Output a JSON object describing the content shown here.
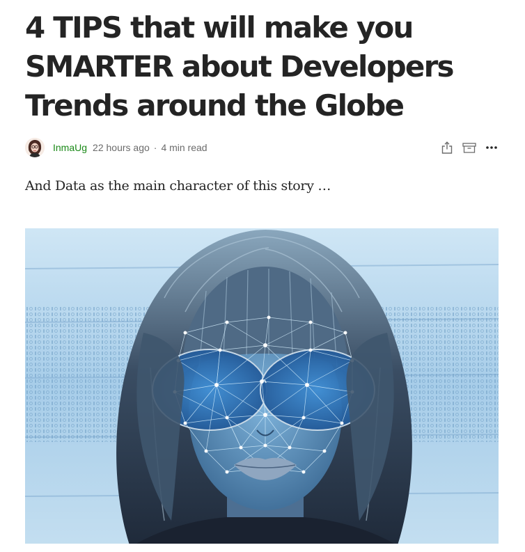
{
  "article": {
    "title_lines": [
      "4 TIPS that will make you",
      "SMARTER about Developers",
      "Trends around the Globe"
    ],
    "subtitle": "And Data as the main character of this story …"
  },
  "meta": {
    "author": "InmaUg",
    "published": "22 hours ago",
    "separator": "·",
    "read_time": "4 min read"
  },
  "actions": {
    "share_icon": "share-icon",
    "archive_icon": "archive-icon",
    "more_icon": "more-icon"
  },
  "colors": {
    "text": "#242424",
    "muted": "#6b6b6b",
    "author_green": "#1a8917",
    "image_blue": "#9fc8e6"
  }
}
